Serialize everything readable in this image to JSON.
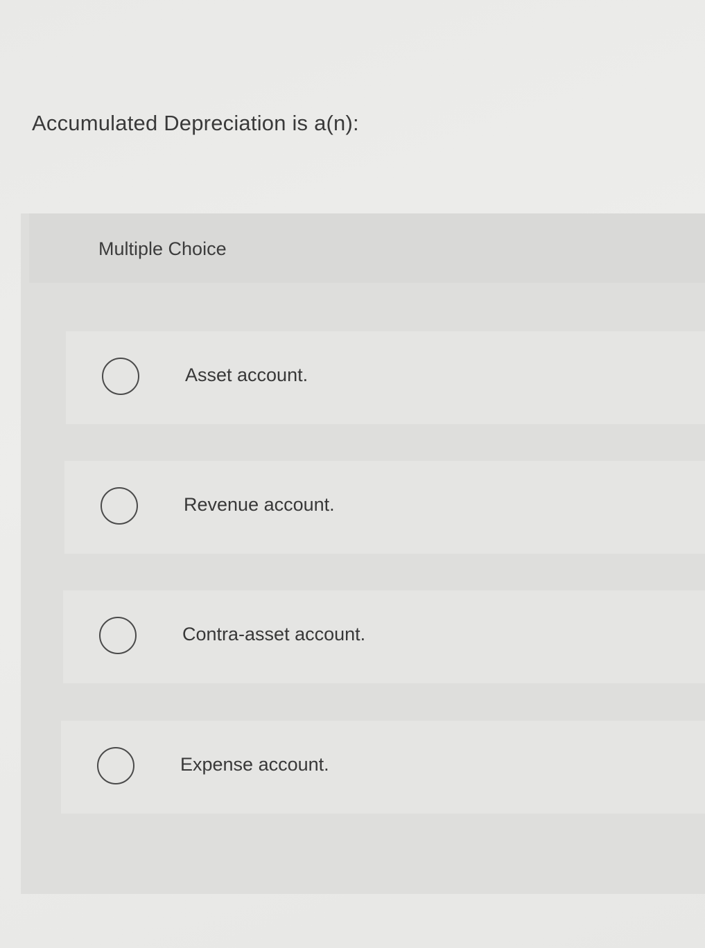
{
  "question": {
    "title": "Accumulated Depreciation is a(n):"
  },
  "panel": {
    "label": "Multiple Choice"
  },
  "options": [
    {
      "label": "Asset account.",
      "selected": false
    },
    {
      "label": "Revenue account.",
      "selected": false
    },
    {
      "label": "Contra-asset account.",
      "selected": false
    },
    {
      "label": "Expense account.",
      "selected": false
    }
  ]
}
